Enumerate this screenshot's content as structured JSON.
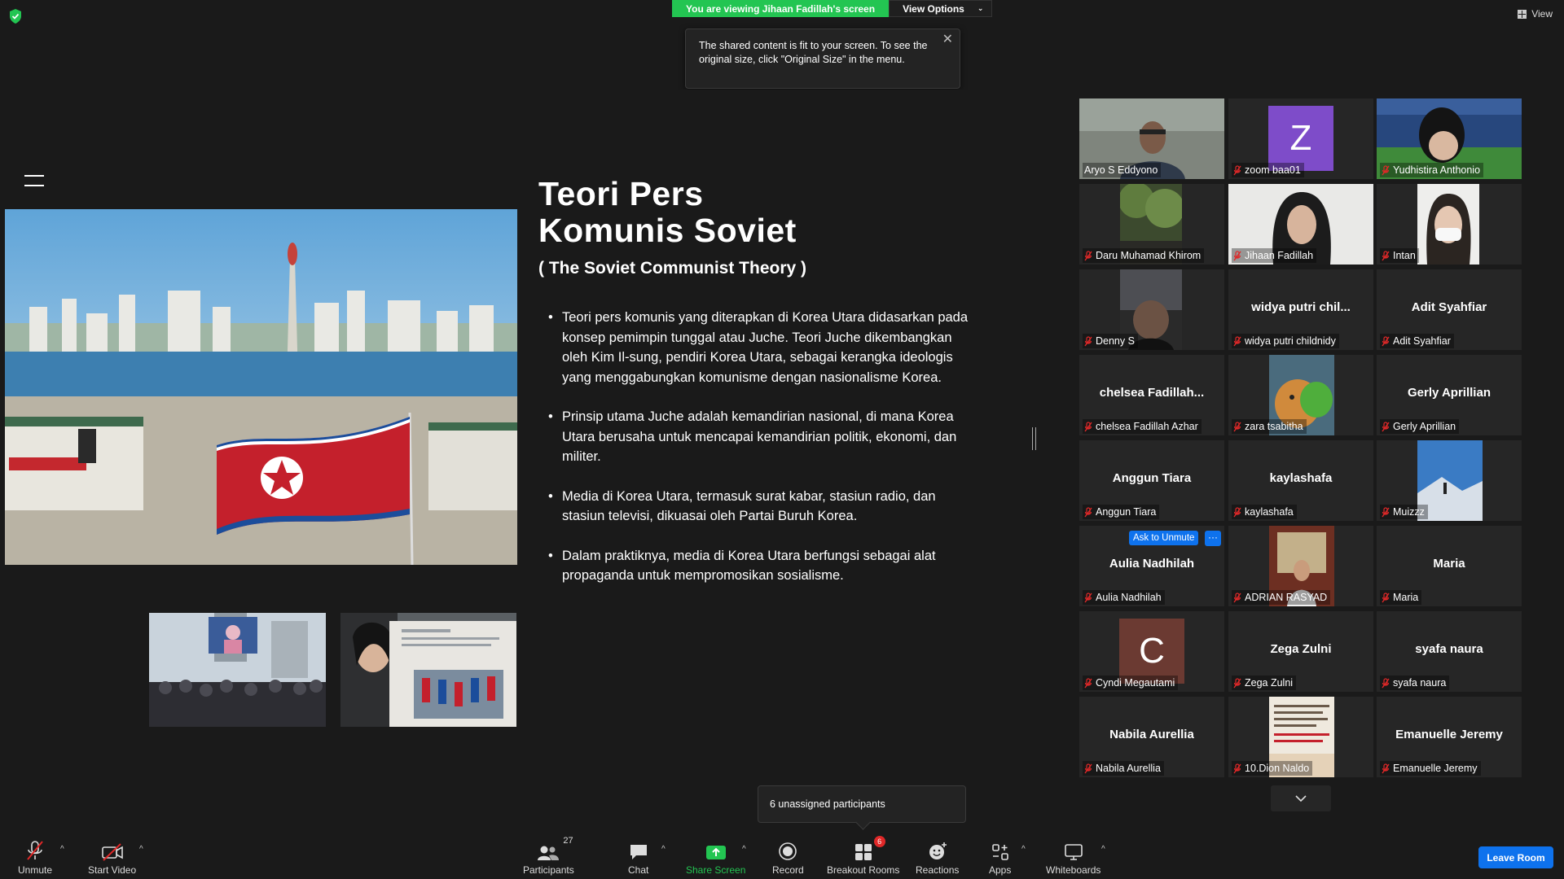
{
  "banner": {
    "viewing_text": "You are viewing Jihaan Fadillah's screen",
    "view_options": "View Options"
  },
  "view_button": "View",
  "tooltip": {
    "text": "The shared content is fit to your screen. To see the original size, click \"Original Size\" in the menu."
  },
  "slide": {
    "title_line1": "Teori Pers",
    "title_line2": "Komunis Soviet",
    "subtitle": "( The Soviet Communist Theory )",
    "bullets": [
      "Teori pers komunis yang diterapkan di Korea Utara didasarkan pada konsep pemimpin tunggal atau Juche. Teori Juche dikembangkan oleh Kim Il-sung, pendiri Korea Utara, sebagai kerangka ideologis yang menggabungkan komunisme dengan nasionalisme Korea.",
      "Prinsip utama Juche adalah kemandirian nasional, di mana Korea Utara berusaha untuk mencapai kemandirian politik, ekonomi, dan militer.",
      "Media di Korea Utara, termasuk surat kabar, stasiun radio, dan stasiun televisi, dikuasai oleh Partai Buruh Korea.",
      "Dalam praktiknya, media di Korea Utara berfungsi sebagai alat propaganda untuk mempromosikan sosialisme."
    ]
  },
  "participants": [
    {
      "label": "Aryo S Eddyono",
      "center": "",
      "kind": "video-man"
    },
    {
      "label": "zoom baa01",
      "center": "",
      "kind": "letter-z"
    },
    {
      "label": "Yudhistira Anthonio",
      "center": "",
      "kind": "video-stadium"
    },
    {
      "label": "Daru Muhamad Khirom",
      "center": "",
      "kind": "video-tree"
    },
    {
      "label": "Jihaan Fadillah",
      "center": "",
      "kind": "video-woman"
    },
    {
      "label": "Intan",
      "center": "",
      "kind": "video-mask"
    },
    {
      "label": "Denny S",
      "center": "",
      "kind": "video-dark"
    },
    {
      "label": "widya putri childnidy",
      "center": "widya  putri  chil...",
      "kind": "name"
    },
    {
      "label": "Adit Syahfiar",
      "center": "Adit Syahfiar",
      "kind": "name"
    },
    {
      "label": "chelsea Fadillah Azhar",
      "center": "chelsea  Fadillah...",
      "kind": "name"
    },
    {
      "label": "zara tsabitha",
      "center": "",
      "kind": "video-cat"
    },
    {
      "label": "Gerly Aprillian",
      "center": "Gerly Aprillian",
      "kind": "name"
    },
    {
      "label": "Anggun Tiara",
      "center": "Anggun Tiara",
      "kind": "name"
    },
    {
      "label": "kaylashafa",
      "center": "kaylashafa",
      "kind": "name"
    },
    {
      "label": "Muizzz",
      "center": "",
      "kind": "video-mountain"
    },
    {
      "label": "Aulia Nadhilah",
      "center": "Aulia Nadhilah",
      "kind": "name"
    },
    {
      "label": "ADRIAN RASYAD",
      "center": "",
      "kind": "video-room"
    },
    {
      "label": "Maria",
      "center": "Maria",
      "kind": "name"
    },
    {
      "label": "Cyndi Megautami",
      "center": "",
      "kind": "letter-c"
    },
    {
      "label": "Zega Zulni",
      "center": "Zega Zulni",
      "kind": "name"
    },
    {
      "label": "syafa naura",
      "center": "syafa naura",
      "kind": "name"
    },
    {
      "label": "Nabila Aurellia",
      "center": "Nabila Aurellia",
      "kind": "name"
    },
    {
      "label": "10.Dion Naldo",
      "center": "",
      "kind": "video-text"
    },
    {
      "label": "Emanuelle Jeremy",
      "center": "Emanuelle Jeremy",
      "kind": "name"
    }
  ],
  "tile_letters": {
    "z": "Z",
    "c": "C"
  },
  "ask_unmute": "Ask to Unmute",
  "ask_more": "···",
  "unassigned": "6 unassigned participants",
  "toolbar": {
    "unmute": "Unmute",
    "start_video": "Start Video",
    "participants": "Participants",
    "participants_count": "27",
    "chat": "Chat",
    "share_screen": "Share Screen",
    "record": "Record",
    "breakout_rooms": "Breakout Rooms",
    "breakout_badge": "6",
    "reactions": "Reactions",
    "apps": "Apps",
    "whiteboards": "Whiteboards",
    "leave_room": "Leave Room"
  },
  "colors": {
    "accent_green": "#23c552",
    "accent_blue": "#0e72ed",
    "active_speaker": "#dfe34b",
    "muted_red": "#e02828"
  }
}
